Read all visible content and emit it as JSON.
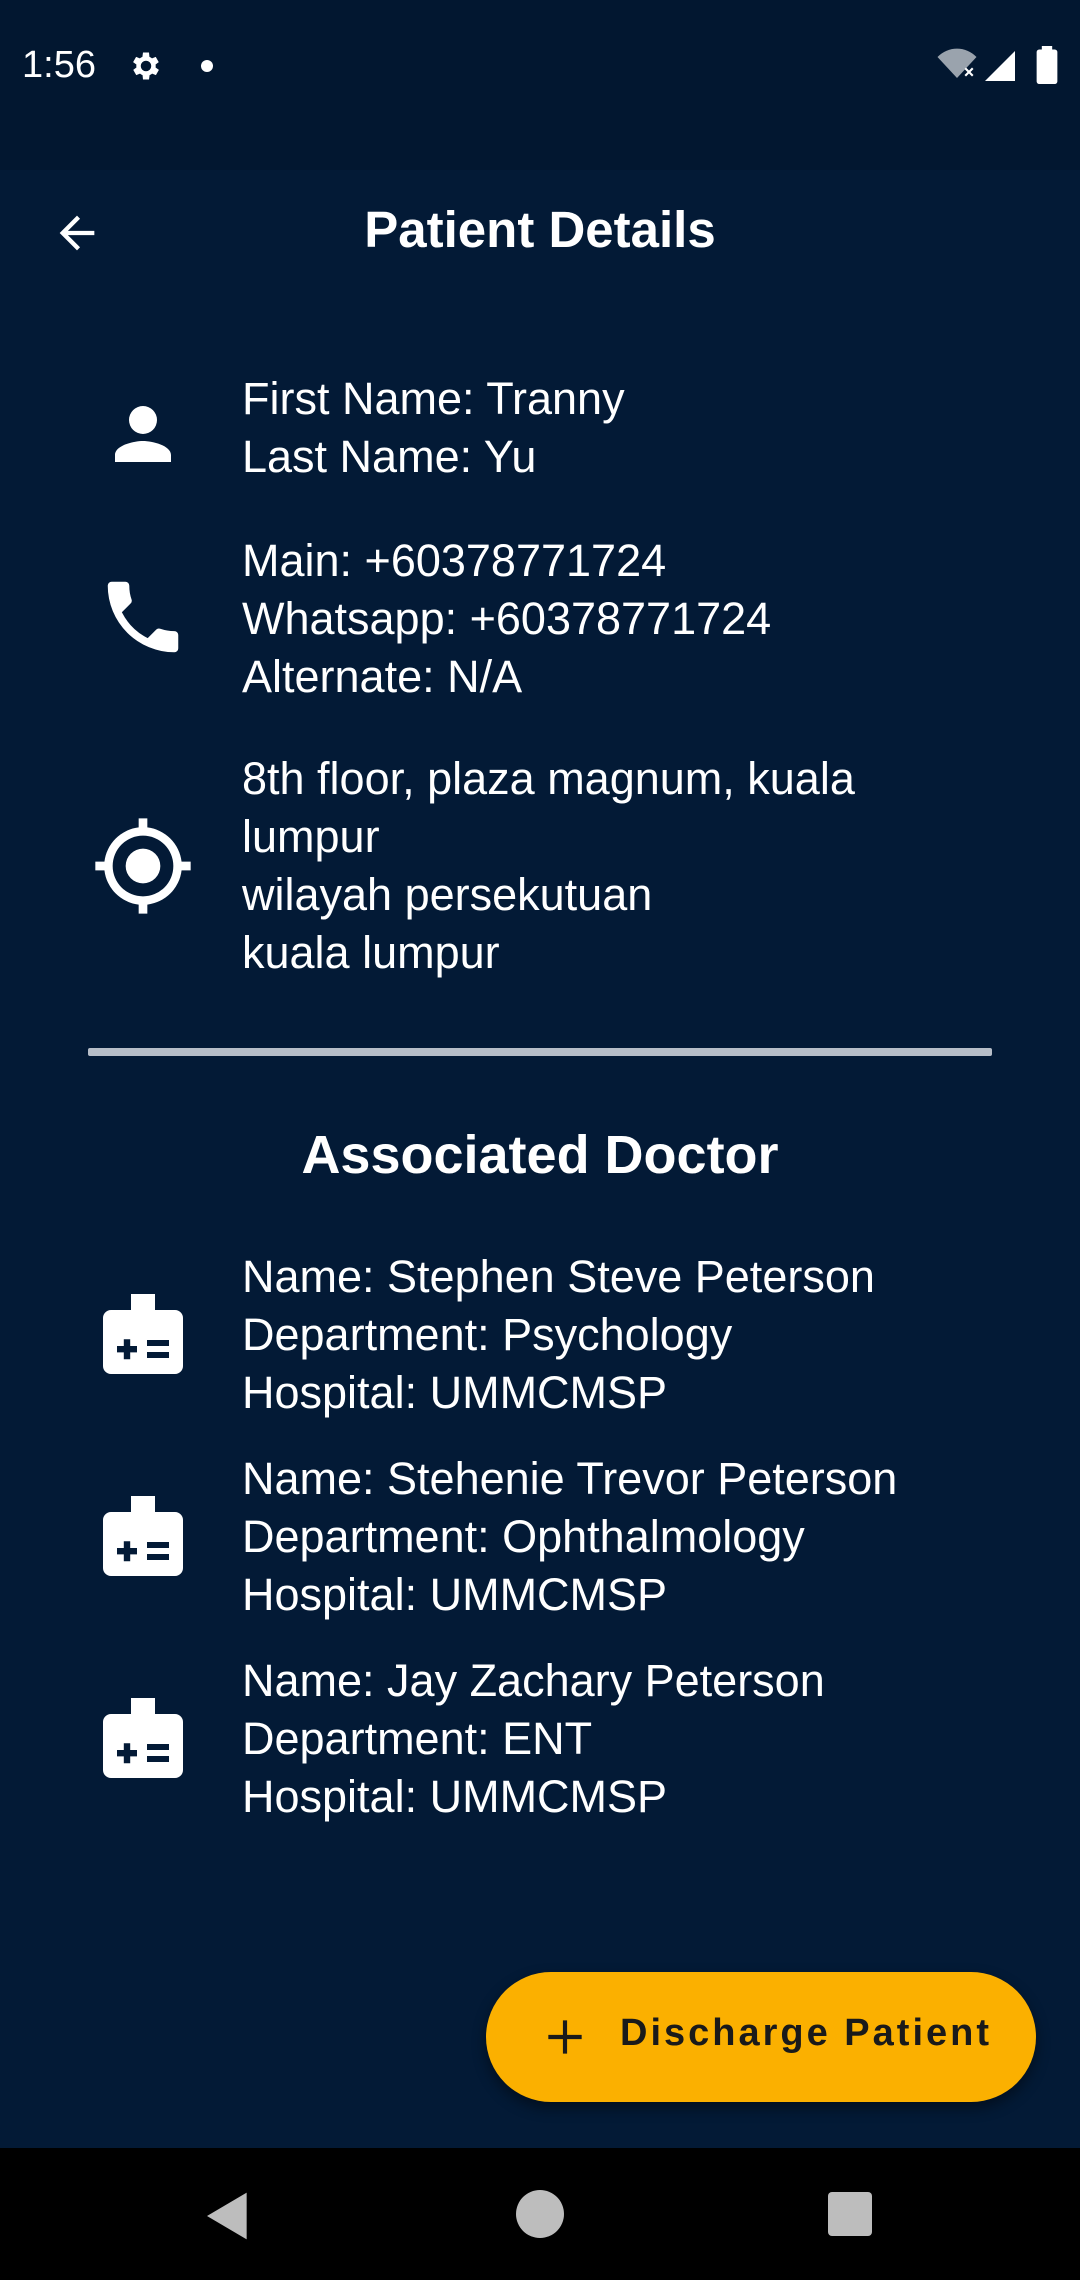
{
  "status_bar": {
    "time": "1:56"
  },
  "app_bar": {
    "title": "Patient Details"
  },
  "patient": {
    "name_lines": [
      "First Name: Tranny",
      "Last Name: Yu"
    ],
    "contact_lines": [
      "Main: +60378771724",
      "Whatsapp: +60378771724",
      "Alternate: N/A"
    ],
    "address_lines": [
      "8th floor, plaza magnum, kuala lumpur",
      "wilayah persekutuan",
      "kuala lumpur"
    ]
  },
  "associated_doctor": {
    "title": "Associated Doctor",
    "doctors": [
      {
        "name": "Name: Stephen Steve Peterson",
        "department": "Department: Psychology",
        "hospital": "Hospital: UMMCMSP"
      },
      {
        "name": "Name: Stehenie Trevor Peterson",
        "department": "Department: Ophthalmology",
        "hospital": "Hospital: UMMCMSP"
      },
      {
        "name": "Name: Jay Zachary Peterson",
        "department": "Department: ENT",
        "hospital": "Hospital: UMMCMSP"
      }
    ]
  },
  "fab": {
    "label": "Discharge Patient",
    "icon": "plus-icon",
    "color": "#fbb000"
  },
  "colors": {
    "background": "#031a36",
    "status_bar": "#021730",
    "text": "#ffffff"
  },
  "icons": {
    "back": "arrow-back-icon",
    "person": "person-icon",
    "phone": "phone-icon",
    "location": "gps-fixed-icon",
    "doctor": "medical-id-icon"
  }
}
